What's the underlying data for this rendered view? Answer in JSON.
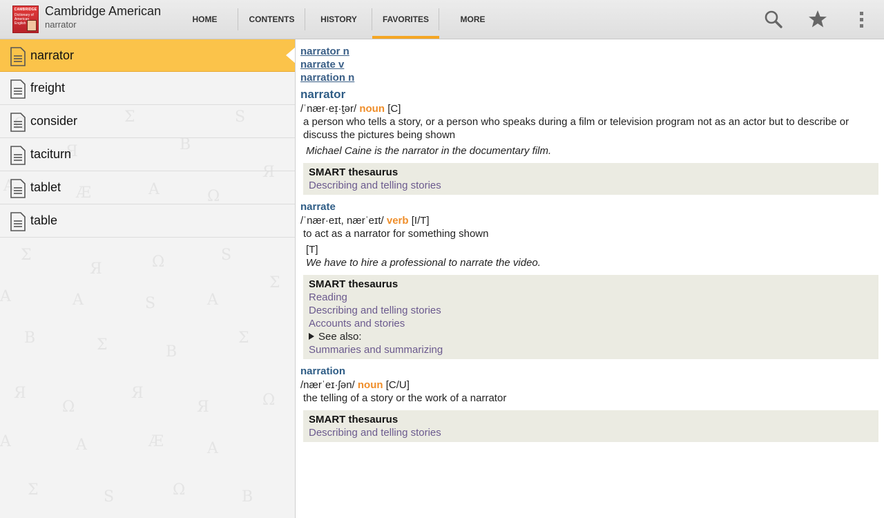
{
  "app": {
    "title": "Cambridge American",
    "subtitle": "narrator",
    "logo_text_top": "CAMBRIDGE",
    "logo_text": "Dictionary of American English"
  },
  "tabs": [
    {
      "label": "HOME"
    },
    {
      "label": "CONTENTS"
    },
    {
      "label": "HISTORY"
    },
    {
      "label": "FAVORITES",
      "active": true
    },
    {
      "label": "MORE"
    }
  ],
  "actions": {
    "icons": [
      "search-icon",
      "star-icon",
      "overflow-menu-icon"
    ]
  },
  "favorites": [
    {
      "label": "narrator",
      "selected": true
    },
    {
      "label": "freight"
    },
    {
      "label": "consider"
    },
    {
      "label": "taciturn"
    },
    {
      "label": "tablet"
    },
    {
      "label": "table"
    }
  ],
  "entry": {
    "links": [
      "narrator n",
      "narrate v",
      "narration n"
    ],
    "narrator": {
      "headword": "narrator",
      "pron": "/ˈnær·eɪ̩·t̬ər/",
      "pos": "noun",
      "gram": "[C]",
      "definition": "a person who tells a story, or a person who speaks during a film or television program not as an actor but to describe or discuss the pictures being shown",
      "example": "Michael Caine is the narrator in the documentary film.",
      "thesaurus_title": "SMART thesaurus",
      "thesaurus_links": [
        "Describing and telling stories"
      ]
    },
    "narrate": {
      "headword": "narrate",
      "pron": "/ˈnær·eɪt, nærˈeɪt/",
      "pos": "verb",
      "gram": "[I/T]",
      "definition": "to act as a narrator for something shown",
      "gram2": "[T]",
      "example": "We have to hire a professional to narrate the video.",
      "thesaurus_title": "SMART thesaurus",
      "thesaurus_links": [
        "Reading",
        "Describing and telling stories",
        "Accounts and stories"
      ],
      "see_also_label": "See also:",
      "see_also_links": [
        "Summaries and summarizing"
      ]
    },
    "narration": {
      "headword": "narration",
      "pron": "/nærˈeɪ·ʃən/",
      "pos": "noun",
      "gram": "[C/U]",
      "definition": "the telling of a story or the work of a narrator",
      "thesaurus_title": "SMART thesaurus",
      "thesaurus_links": [
        "Describing and telling stories"
      ]
    }
  },
  "colors": {
    "accent": "#f5a623",
    "selected_row": "#fbc34a",
    "headword": "#2f5d86",
    "pos": "#ef8e2a",
    "thesaurus_link": "#6b5a8e"
  }
}
